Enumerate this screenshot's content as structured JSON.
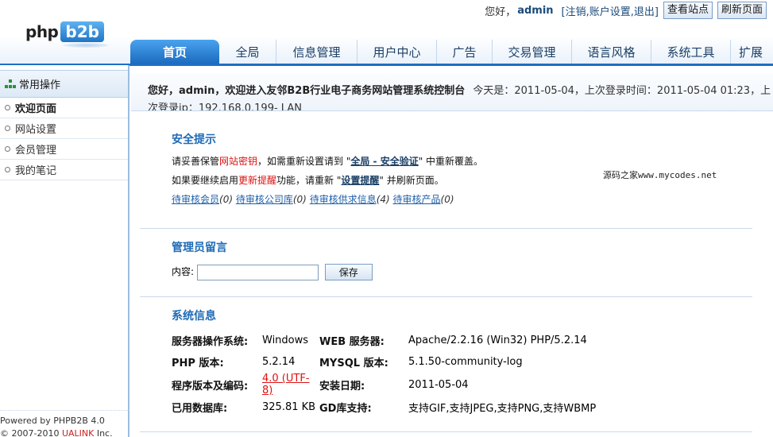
{
  "header": {
    "logo_php": "php",
    "logo_b2b": "b2b",
    "greeting": "您好，",
    "username": "admin",
    "user_links": "[注销,账户设置,退出]",
    "view_site": "查看站点",
    "refresh": "刷新页面"
  },
  "nav": {
    "items": [
      "首页",
      "全局",
      "信息管理",
      "用户中心",
      "广告",
      "交易管理",
      "语言风格",
      "系统工具",
      "扩展"
    ]
  },
  "sidebar": {
    "title": "常用操作",
    "items": [
      "欢迎页面",
      "网站设置",
      "会员管理",
      "我的笔记"
    ],
    "footer_line1": "Powered by PHPB2B 4.0",
    "footer_line2_pre": "© 2007-2010 ",
    "footer_line2_link": "UALINK",
    "footer_line2_post": " Inc."
  },
  "welcome": {
    "pre": "您好，",
    "user": "admin",
    "mid": "，欢迎进入友邻B2B行业电子商务网站管理系统控制台",
    "rest": "今天是：2011-05-04，上次登录时间：2011-05-04 01:23，上次登录ip：192.168.0.199- LAN"
  },
  "security": {
    "title": "安全提示",
    "l1_a": "请妥善保管",
    "l1_red": "网站密钥",
    "l1_b": "，如需重新设置请到 \"",
    "l1_link": "全局 - 安全验证",
    "l1_c": "\" 中重新覆盖。",
    "l2_a": "如果要继续启用",
    "l2_red": "更新提醒",
    "l2_b": "功能，请重新 \"",
    "l2_link": "设置提醒",
    "l2_c": "\" 并刷新页面。",
    "pending": [
      {
        "label": "待审核会员",
        "count": "(0)"
      },
      {
        "label": "待审核公司库",
        "count": "(0)"
      },
      {
        "label": "待审核供求信息",
        "count": "(4)"
      },
      {
        "label": "待审核产品",
        "count": "(0)"
      }
    ],
    "watermark": "源码之家www.mycodes.net"
  },
  "message": {
    "title": "管理员留言",
    "label": "内容:",
    "input_value": "",
    "save": "保存"
  },
  "sysinfo": {
    "title": "系统信息",
    "rows": [
      {
        "k1": "服务器操作系统:",
        "v1": "Windows",
        "k2": "WEB 服务器:",
        "v2": "Apache/2.2.16 (Win32) PHP/5.2.14"
      },
      {
        "k1": "PHP 版本:",
        "v1": "5.2.14",
        "k2": "MYSQL 版本:",
        "v2": "5.1.50-community-log"
      },
      {
        "k1": "程序版本及编码:",
        "v1": "4.0 (UTF-8)",
        "k2": "安装日期:",
        "v2": "2011-05-04"
      },
      {
        "k1": "已用数据库:",
        "v1": "325.81 KB",
        "k2": "GD库支持:",
        "v2": "支持GIF,支持JPEG,支持PNG,支持WBMP"
      }
    ]
  }
}
